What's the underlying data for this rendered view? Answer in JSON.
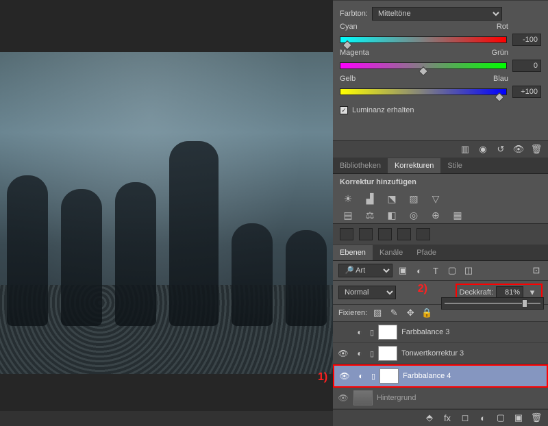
{
  "color_balance": {
    "tone_label": "Farbton:",
    "tone_value": "Mitteltöne",
    "sliders": [
      {
        "left": "Cyan",
        "right": "Rot",
        "value": "-100",
        "pos": 4
      },
      {
        "left": "Magenta",
        "right": "Grün",
        "value": "0",
        "pos": 50
      },
      {
        "left": "Gelb",
        "right": "Blau",
        "value": "+100",
        "pos": 96
      }
    ],
    "preserve_lum": "Luminanz erhalten"
  },
  "tabs_adjust": {
    "lib": "Bibliotheken",
    "corr": "Korrekturen",
    "stile": "Stile"
  },
  "adj_title": "Korrektur hinzufügen",
  "tabs_layers": {
    "ebenen": "Ebenen",
    "kan": "Kanäle",
    "pfade": "Pfade"
  },
  "filter": "Art",
  "blend": "Normal",
  "opacity_label": "Deckkraft:",
  "opacity_value": "81%",
  "lock_label": "Fixieren:",
  "layers": [
    {
      "name": "Farbbalance 3",
      "visible": false
    },
    {
      "name": "Tonwertkorrektur 3",
      "visible": true
    },
    {
      "name": "Farbbalance 4",
      "visible": true,
      "selected": true
    },
    {
      "name": "Hintergrund",
      "visible": true,
      "image": true
    }
  ],
  "annotations": {
    "a1": "1)",
    "a2": "2)"
  }
}
